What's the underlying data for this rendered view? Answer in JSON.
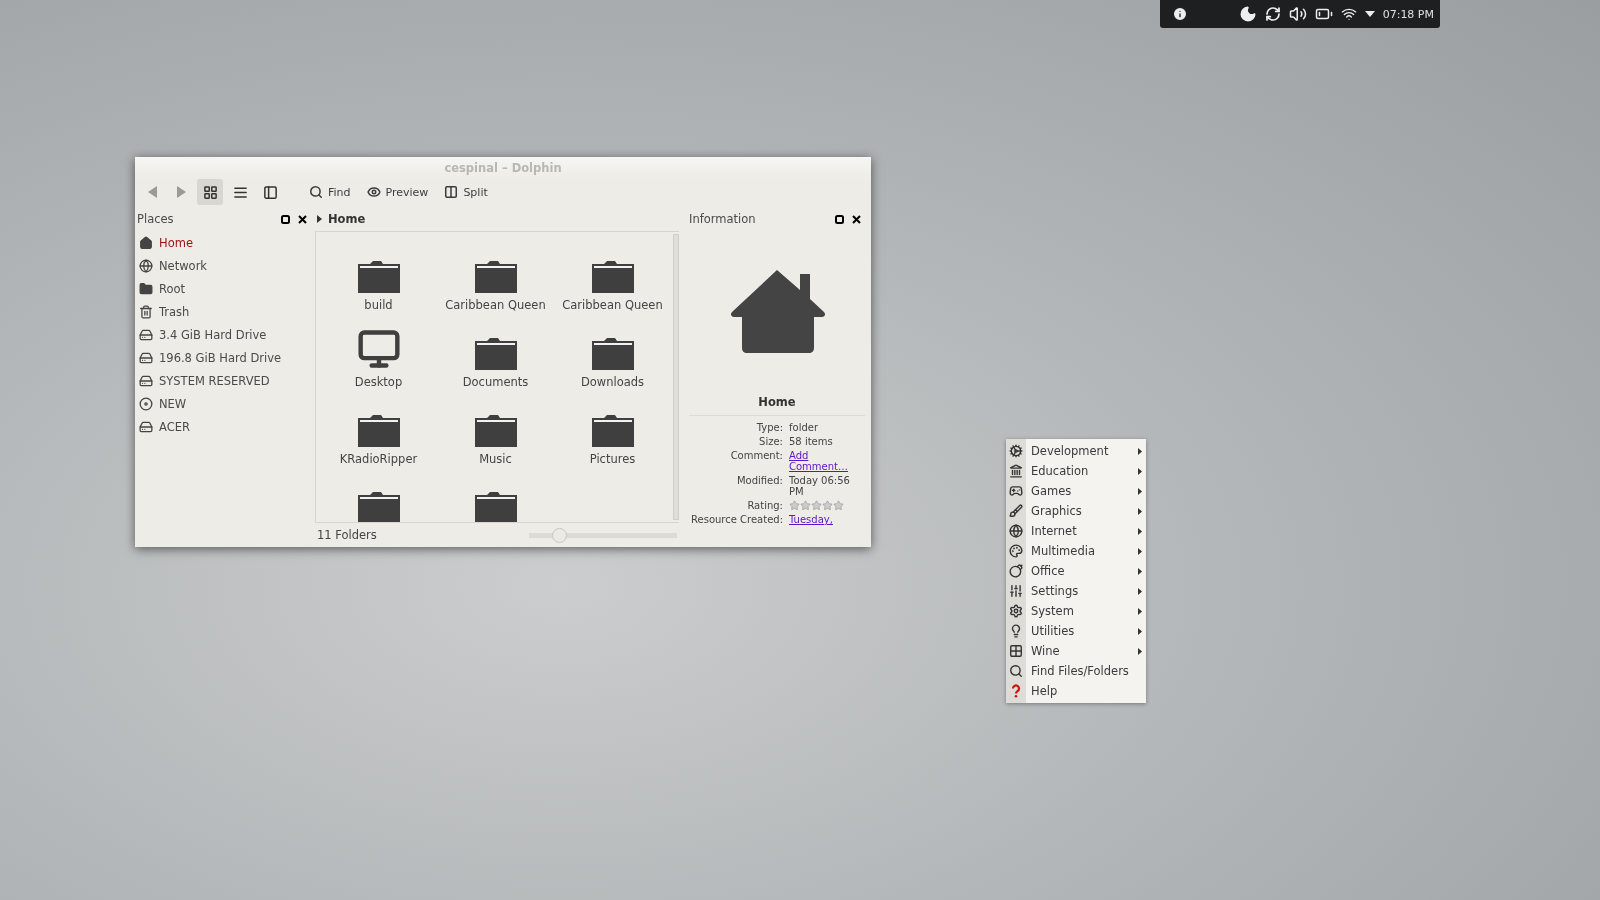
{
  "panel": {
    "clock": "07:18 PM"
  },
  "window": {
    "title": "cespinal – Dolphin"
  },
  "toolbar": {
    "views": [
      {
        "kind": "icons",
        "selected": true
      },
      {
        "kind": "compact",
        "selected": false
      },
      {
        "kind": "details",
        "selected": false
      }
    ],
    "buttons": [
      {
        "kind": "find",
        "label": "Find"
      },
      {
        "kind": "preview",
        "label": "Preview"
      },
      {
        "kind": "split",
        "label": "Split"
      }
    ]
  },
  "places": {
    "title": "Places",
    "items": [
      {
        "label": "Home",
        "kind": "home",
        "selected": true
      },
      {
        "label": "Network",
        "kind": "network",
        "selected": false
      },
      {
        "label": "Root",
        "kind": "folder",
        "selected": false
      },
      {
        "label": "Trash",
        "kind": "trash",
        "selected": false
      },
      {
        "label": "3.4 GiB Hard Drive",
        "kind": "drive",
        "selected": false
      },
      {
        "label": "196.8 GiB Hard Drive",
        "kind": "drive",
        "selected": false
      },
      {
        "label": "SYSTEM RESERVED",
        "kind": "drive",
        "selected": false
      },
      {
        "label": "NEW",
        "kind": "disc",
        "selected": false
      },
      {
        "label": "ACER",
        "kind": "drive",
        "selected": false
      }
    ]
  },
  "breadcrumb": "Home",
  "files": [
    {
      "name": "build",
      "kind": "folder"
    },
    {
      "name": "Caribbean Queen",
      "kind": "folder"
    },
    {
      "name": "Caribbean Queen",
      "kind": "folder"
    },
    {
      "name": "Desktop",
      "kind": "desktop"
    },
    {
      "name": "Documents",
      "kind": "folder"
    },
    {
      "name": "Downloads",
      "kind": "folder"
    },
    {
      "name": "KRadioRipper",
      "kind": "folder"
    },
    {
      "name": "Music",
      "kind": "folder"
    },
    {
      "name": "Pictures",
      "kind": "folder"
    },
    {
      "kind": "folder"
    },
    {
      "kind": "folder"
    }
  ],
  "status": {
    "text": "11 Folders",
    "zoom": {
      "level": 0.2
    }
  },
  "information": {
    "title": "Information",
    "name": "Home",
    "fields": [
      {
        "label": "Type:",
        "kind": "text",
        "value": "folder"
      },
      {
        "label": "Size:",
        "kind": "text",
        "value": "58 items"
      },
      {
        "label": "Comment:",
        "kind": "link",
        "value": "Add Comment…"
      },
      {
        "label": "Modified:",
        "kind": "text",
        "value": "Today 06:56 PM"
      },
      {
        "label": "Rating:",
        "kind": "rating",
        "stars": 0
      },
      {
        "label": "Resource Created:",
        "kind": "link",
        "value": "Tuesday,"
      }
    ]
  },
  "menu": {
    "items": [
      {
        "label": "Development",
        "kind": "development",
        "submenu": true
      },
      {
        "label": "Education",
        "kind": "education",
        "submenu": true
      },
      {
        "label": "Games",
        "kind": "games",
        "submenu": true
      },
      {
        "label": "Graphics",
        "kind": "graphics",
        "submenu": true
      },
      {
        "label": "Internet",
        "kind": "internet",
        "submenu": true
      },
      {
        "label": "Multimedia",
        "kind": "multimedia",
        "submenu": true
      },
      {
        "label": "Office",
        "kind": "office",
        "submenu": true
      },
      {
        "label": "Settings",
        "kind": "settings",
        "submenu": true
      },
      {
        "label": "System",
        "kind": "system",
        "submenu": true
      },
      {
        "label": "Utilities",
        "kind": "utilities",
        "submenu": true
      },
      {
        "label": "Wine",
        "kind": "wine",
        "submenu": true
      },
      {
        "label": "Find Files/Folders",
        "kind": "find",
        "submenu": false
      },
      {
        "label": "Help",
        "kind": "help",
        "submenu": false
      }
    ]
  }
}
